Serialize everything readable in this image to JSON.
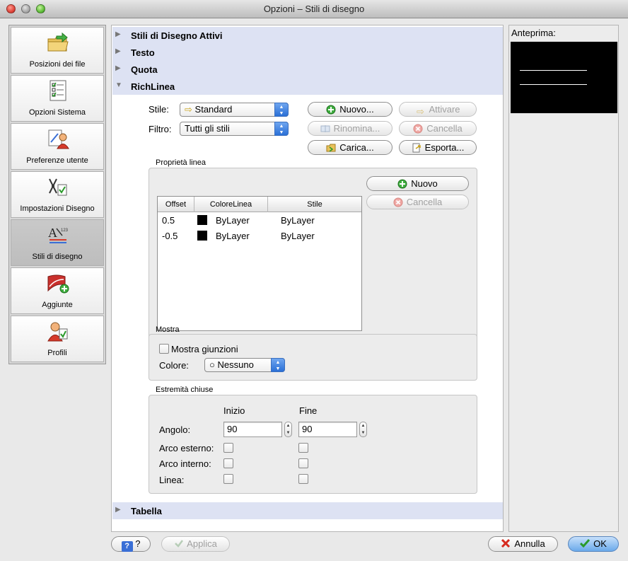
{
  "window": {
    "title": "Opzioni – Stili di disegno"
  },
  "sidebar": {
    "items": [
      {
        "label": "Posizioni dei file",
        "icon": "folder-arrow-icon"
      },
      {
        "label": "Opzioni Sistema",
        "icon": "checklist-icon"
      },
      {
        "label": "Preferenze utente",
        "icon": "user-preferences-icon"
      },
      {
        "label": "Impostazioni Disegno",
        "icon": "drawing-settings-icon"
      },
      {
        "label": "Stili di disegno",
        "icon": "drawing-styles-icon",
        "active": true
      },
      {
        "label": "Aggiunte",
        "icon": "addins-icon"
      },
      {
        "label": "Profili",
        "icon": "profiles-icon"
      }
    ]
  },
  "sections": {
    "active_styles": "Stili di Disegno Attivi",
    "text": "Testo",
    "dimension": "Quota",
    "multiline": "RichLinea",
    "table": "Tabella"
  },
  "multiline": {
    "style_label": "Stile:",
    "style_value": "Standard",
    "filter_label": "Filtro:",
    "filter_value": "Tutti gli stili",
    "buttons": {
      "new": "Nuovo...",
      "activate": "Attivare",
      "rename": "Rinomina...",
      "delete": "Cancella",
      "load": "Carica...",
      "export": "Esporta..."
    },
    "properties": {
      "title": "Proprietà linea",
      "columns": [
        "Offset",
        "ColoreLinea",
        "Stile"
      ],
      "rows": [
        {
          "offset": "0.5",
          "color": "ByLayer",
          "style": "ByLayer"
        },
        {
          "offset": "-0.5",
          "color": "ByLayer",
          "style": "ByLayer"
        }
      ],
      "new_button": "Nuovo",
      "delete_button": "Cancella"
    },
    "display": {
      "title": "Mostra",
      "show_joints": "Mostra giunzioni",
      "color_label": "Colore:",
      "color_value": "Nessuno"
    },
    "caps": {
      "title": "Estremità chiuse",
      "start": "Inizio",
      "end": "Fine",
      "angle_label": "Angolo:",
      "angle_start": "90",
      "angle_end": "90",
      "outer_arc": "Arco esterno:",
      "inner_arc": "Arco interno:",
      "line": "Linea:"
    }
  },
  "preview": {
    "title": "Anteprima:"
  },
  "footer": {
    "help": "?",
    "apply": "Applica",
    "cancel": "Annulla",
    "ok": "OK"
  },
  "colors": {
    "section_header": "#dde2f3",
    "accent_blue": "#2a6fd6",
    "preview_bg": "#000000"
  }
}
